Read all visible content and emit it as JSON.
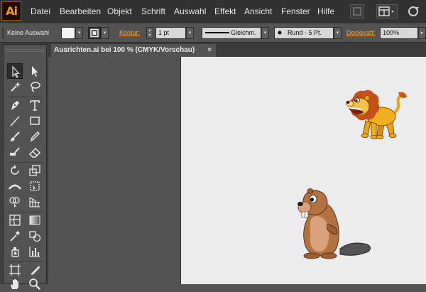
{
  "app": {
    "logo": "Ai",
    "menu": [
      "Datei",
      "Bearbeiten",
      "Objekt",
      "Schrift",
      "Auswahl",
      "Effekt",
      "Ansicht",
      "Fenster",
      "Hilfe"
    ],
    "accent": "#f39a1e"
  },
  "control": {
    "selection": "Keine Auswahl",
    "stroke_label": "Kontur:",
    "stroke_weight": "1 pt",
    "stroke_style": "Gleichm.",
    "brush": "Rund - 5 Pt.",
    "opacity_label": "Deckkraft:",
    "opacity_value": "100%"
  },
  "document": {
    "tab_title": "Ausrichten.ai bei 100 % (CMYK/Vorschau)",
    "close_glyph": "×"
  },
  "panel": {
    "collapse_glyph": "◂◂",
    "tools": [
      "selection",
      "direct-selection",
      "magic-wand",
      "lasso",
      "pen",
      "type",
      "line-segment",
      "rectangle",
      "paintbrush",
      "pencil",
      "blob-brush",
      "eraser",
      "rotate",
      "scale",
      "width",
      "free-transform",
      "shape-builder",
      "perspective-grid",
      "mesh",
      "gradient",
      "eyedropper",
      "blend",
      "symbol-sprayer",
      "column-graph",
      "artboard",
      "slice",
      "hand",
      "zoom"
    ]
  },
  "canvas": {
    "artwork": [
      "lion-illustration",
      "beaver-illustration"
    ]
  }
}
